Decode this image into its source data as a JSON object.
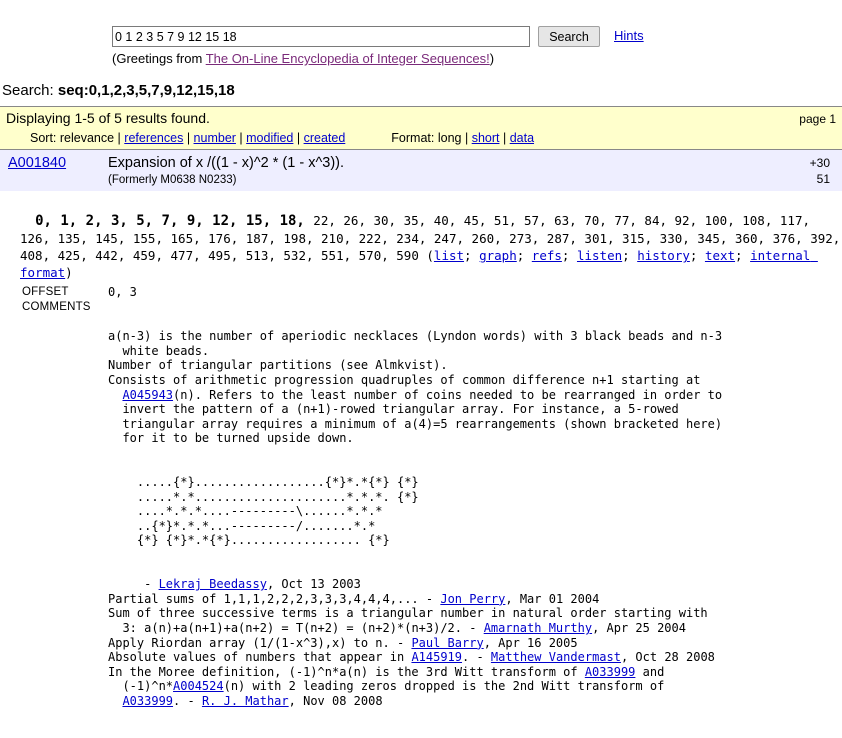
{
  "search": {
    "input_value": "0 1 2 3 5 7 9 12 15 18",
    "placeholder": "",
    "button_label": "Search",
    "hints_label": "Hints",
    "greeting_prefix": "(Greetings from ",
    "greeting_link": "The On-Line Encyclopedia of Integer Sequences!",
    "greeting_suffix": ")"
  },
  "search_echo": {
    "label": "Search: ",
    "query": "seq:0,1,2,3,5,7,9,12,15,18"
  },
  "banner": {
    "displaying": "Displaying 1-5 of 5 results found.",
    "page": "page 1",
    "sort_label": "Sort: ",
    "sort_current": "relevance",
    "sort_options": [
      "references",
      "number",
      "modified",
      "created"
    ],
    "format_label": "Format: ",
    "format_current": "long",
    "format_options": [
      "short",
      "data"
    ],
    "separator": " | "
  },
  "entry": {
    "aid": "A001840",
    "title": "Expansion of x /((1 - x)^2 * (1 - x^3)).",
    "formerly": "(Formerly M0638 N0233)",
    "refs_count": "+30",
    "refs_second": "51",
    "terms_bold": [
      "0,",
      "1,",
      "2,",
      "3,",
      "5,",
      "7,",
      "9,",
      "12,",
      "15,",
      "18,"
    ],
    "terms_rest": "22, 26, 30, 35, 40, 45, 51, 57, 63, 70, 77, 84, 92, 100, 108, 117, 126, 135, 145, 155, 165, 176, 187, 198, 210, 222, 234, 247, 260, 273, 287, 301, 315, 330, 345, 360, 376, 392, 408, 425, 442, 459, 477, 495, 513, 532, 551, 570, 590",
    "links_open": "(",
    "links": [
      "list",
      "graph",
      "refs",
      "listen",
      "history",
      "text",
      "internal format"
    ],
    "links_sep": "; ",
    "links_close": ")",
    "offset_label": "OFFSET",
    "offset_value": "0, 3",
    "comments_label": "COMMENTS",
    "comments": [
      "a(n-3) is the number of aperiodic necklaces (Lyndon words) with 3 black beads and n-3",
      "  white beads.",
      "Number of triangular partitions (see Almkvist).",
      "Consists of arithmetic progression quadruples of common difference n+1 starting at",
      "  A045943(n). Refers to the least number of coins needed to be rearranged in order to",
      "  invert the pattern of a (n+1)-rowed triangular array. For instance, a 5-rowed",
      "  triangular array requires a minimum of a(4)=5 rearrangements (shown bracketed here)",
      "  for it to be turned upside down."
    ],
    "ascii_art": [
      "    .....{*}..................{*}*.*{*} {*}",
      "    .....*.*.....................*.*.*. {*}",
      "    ....*.*.*....---------\\......*.*.*",
      "    ..{*}*.*.*...---------/.......*.*",
      "    {*} {*}*.*{*}.................. {*}"
    ],
    "attributions": [
      "     - Lekraj Beedassy, Oct 13 2003",
      "Partial sums of 1,1,1,2,2,2,3,3,3,4,4,4,... - Jon Perry, Mar 01 2004",
      "Sum of three successive terms is a triangular number in natural order starting with",
      "  3: a(n)+a(n+1)+a(n+2) = T(n+2) = (n+2)*(n+3)/2. - Amarnath Murthy, Apr 25 2004",
      "Apply Riordan array (1/(1-x^3),x) to n. - Paul Barry, Apr 16 2005",
      "Absolute values of numbers that appear in A145919. - Matthew Vandermast, Oct 28 2008",
      "In the Moree definition, (-1)^n*a(n) is the 3rd Witt transform of A033999 and",
      "  (-1)^n*A004524(n) with 2 leading zeros dropped is the 2nd Witt transform of",
      "  A033999. - R. J. Mathar, Nov 08 2008"
    ],
    "inline_links": [
      "A045943",
      "Lekraj Beedassy",
      "Jon Perry",
      "Amarnath Murthy",
      "Paul Barry",
      "A145919",
      "Matthew Vandermast",
      "A033999",
      "A004524",
      "A033999",
      "R. J. Mathar"
    ]
  },
  "colors": {
    "banner_bg": "#ffffcc",
    "entry_bg": "#eeeeff",
    "link": "#0000cc",
    "visited_link": "#7a2a7a"
  }
}
